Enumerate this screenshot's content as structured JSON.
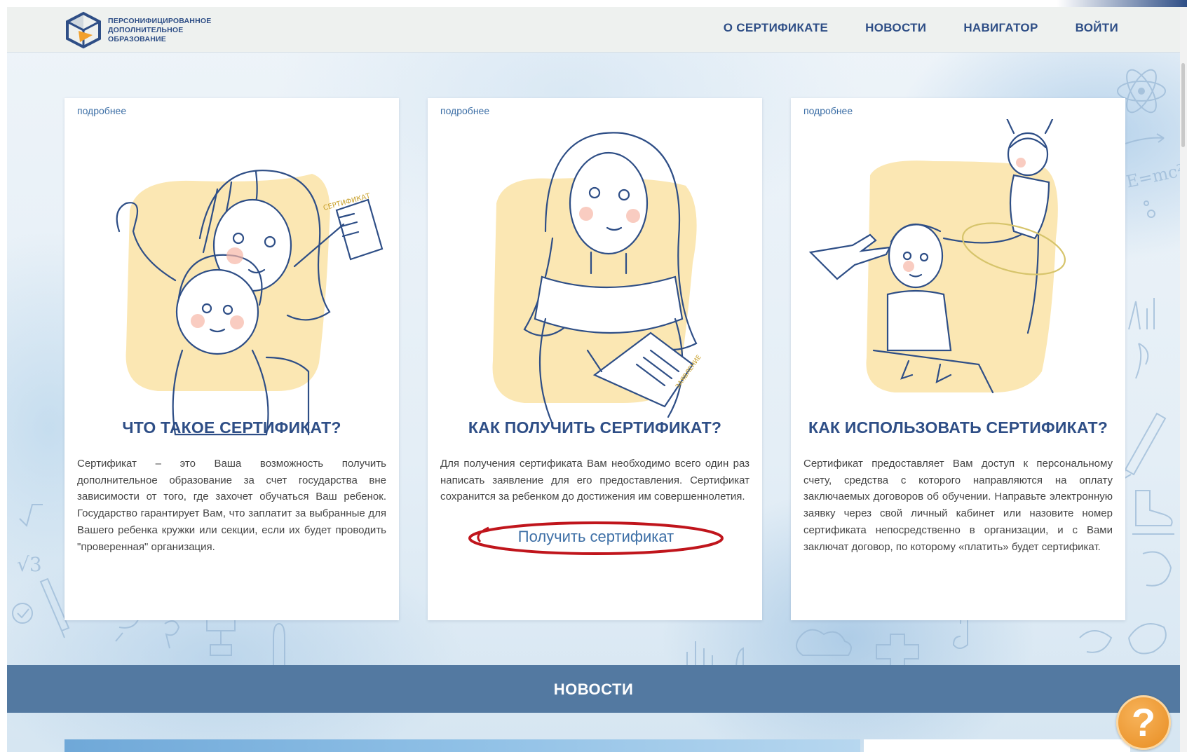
{
  "header": {
    "logo_lines": [
      "ПЕРСОНИФИЦИРОВАННОЕ",
      "ДОПОЛНИТЕЛЬНОЕ",
      "ОБРАЗОВАНИЕ"
    ],
    "nav": [
      "О СЕРТИФИКАТЕ",
      "НОВОСТИ",
      "НАВИГАТОР",
      "ВОЙТИ"
    ]
  },
  "cards": [
    {
      "more": "подробнее",
      "title": "ЧТО ТАКОЕ СЕРТИФИКАТ?",
      "text": "Сертификат – это Ваша возможность получить дополнительное образование за счет государства вне зависимости от того, где захочет обучаться Ваш ребенок. Государство гарантирует Вам, что заплатит за выбранные для Вашего ребенка кружки или секции, если их будет проводить \"проверенная\" организация."
    },
    {
      "more": "подробнее",
      "title": "КАК ПОЛУЧИТЬ СЕРТИФИКАТ?",
      "text": "Для получения сертификата Вам необходимо всего один раз написать заявление для его предоставления. Сертификат сохранится за ребенком до достижения им совершеннолетия.",
      "cta": "Получить сертификат",
      "doc_label": "ЗАЯВЛЕНИЕ"
    },
    {
      "more": "подробнее",
      "title": "КАК ИСПОЛЬЗОВАТЬ СЕРТИФИКАТ?",
      "text": "Сертификат предоставляет Вам доступ к персональному счету, средства с которого направляются на оплату заключаемых договоров об обучении. Направьте электронную заявку через свой личный кабинет или назовите номер сертификата непосредственно в организации, и с Вами заключат договор, по которому «платить» будет сертификат."
    }
  ],
  "card1_doc_label": "СЕРТИФИКАТ",
  "news": {
    "title": "НОВОСТИ"
  },
  "help": {
    "label": "?"
  },
  "colors": {
    "primary": "#2e4e86",
    "link": "#3d6fa6",
    "band": "#5379a1",
    "help": "#e88d22",
    "highlight": "#c0151c",
    "illus_bg": "#fbe7b3"
  },
  "icons": [
    "logo-cube-icon",
    "help-icon",
    "atom-icon",
    "pencil-icon",
    "skate-icon"
  ]
}
